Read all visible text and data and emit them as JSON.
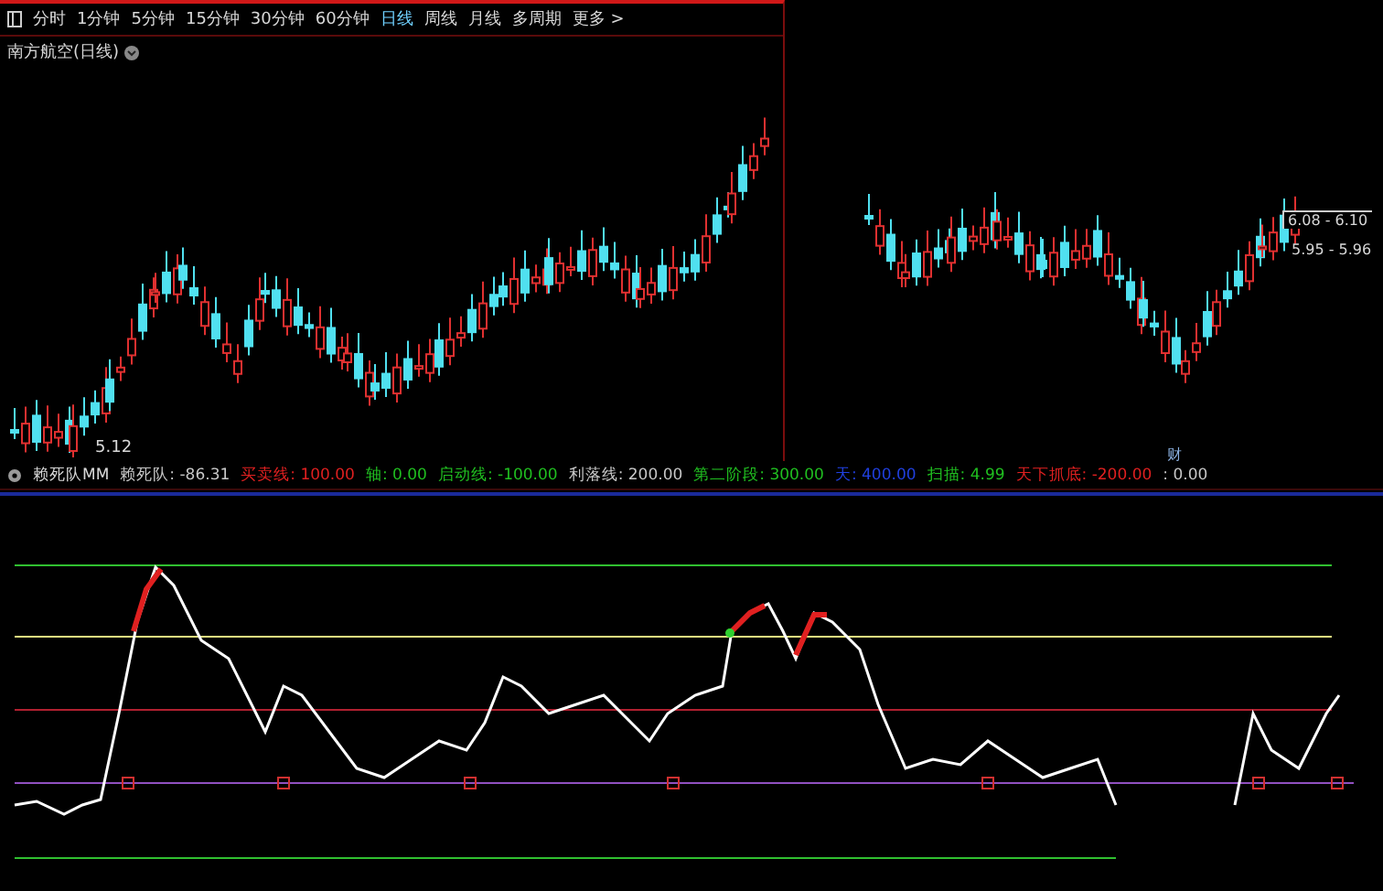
{
  "toolbar": {
    "tabs": [
      {
        "label": "分时",
        "selected": false
      },
      {
        "label": "1分钟",
        "selected": false
      },
      {
        "label": "5分钟",
        "selected": false
      },
      {
        "label": "15分钟",
        "selected": false
      },
      {
        "label": "30分钟",
        "selected": false
      },
      {
        "label": "60分钟",
        "selected": false
      },
      {
        "label": "日线",
        "selected": true
      },
      {
        "label": "周线",
        "selected": false
      },
      {
        "label": "月线",
        "selected": false
      },
      {
        "label": "多周期",
        "selected": false
      },
      {
        "label": "更多 >",
        "selected": false
      }
    ]
  },
  "stock": {
    "title": "南方航空(日线)"
  },
  "price_chart": {
    "low_label": "5.12",
    "marker": "财",
    "labels": [
      {
        "text": "6.08 - 6.10",
        "kind": "boxed"
      },
      {
        "text": "5.95 - 5.96",
        "kind": "plain"
      }
    ]
  },
  "indicator": {
    "name": "赖死队MM",
    "items": [
      {
        "text": "赖死队: -86.31",
        "color": "#c8c8c8"
      },
      {
        "text": "买卖线: 100.00",
        "color": "#e02020"
      },
      {
        "text": "轴: 0.00",
        "color": "#20c020"
      },
      {
        "text": "启动线: -100.00",
        "color": "#20c020"
      },
      {
        "text": "利落线: 200.00",
        "color": "#c8c8c8"
      },
      {
        "text": "第二阶段: 300.00",
        "color": "#20c020"
      },
      {
        "text": "天: 400.00",
        "color": "#2040e0"
      },
      {
        "text": "扫描: 4.99",
        "color": "#20c020"
      },
      {
        "text": "天下抓底: -200.00",
        "color": "#e02020"
      },
      {
        "text": ": 0.00",
        "color": "#c8c8c8"
      }
    ]
  }
}
